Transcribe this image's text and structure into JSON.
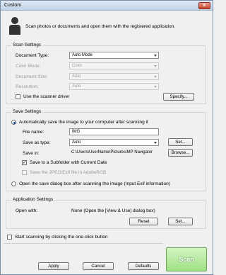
{
  "window": {
    "title": "Custom",
    "close_symbol": "x"
  },
  "intro_text": "Scan photos or documents and open them with the registered application.",
  "scan_settings": {
    "title": "Scan Settings",
    "document_type": {
      "label": "Document Type:",
      "value": "Auto Mode"
    },
    "color_mode": {
      "label": "Color Mode:",
      "value": "Color"
    },
    "document_size": {
      "label": "Document Size:",
      "value": "Auto"
    },
    "resolution": {
      "label": "Resolution:",
      "value": "Auto"
    },
    "use_driver_label": "Use the scanner driver",
    "specify_button": "Specify..."
  },
  "save_settings": {
    "title": "Save Settings",
    "auto_save_label": "Automatically save the image to your computer after scanning it",
    "file_name": {
      "label": "File name:",
      "value": "IMG"
    },
    "save_as_type": {
      "label": "Save as type:",
      "value": "Auto"
    },
    "set_button": "Set...",
    "save_in": {
      "label": "Save in:",
      "value": "C:\\Users\\UserName\\Pictures\\MP Navigator"
    },
    "browse_button": "Browse...",
    "subfolder_label": "Save to a Subfolder with Current Date",
    "jpeg_exif_label": "Save the JPEG/Exif file in AdobeRGB",
    "open_dialog_label": "Open the save dialog box after scanning the image (Input Exif information)"
  },
  "application_settings": {
    "title": "Application Settings",
    "open_with_label": "Open with:",
    "open_with_value": "None (Open the [View & Use] dialog box)",
    "reset_button": "Reset",
    "set_button": "Set..."
  },
  "start_scanning_label": "Start scanning by clicking the one-click button",
  "footer": {
    "apply": "Apply",
    "cancel": "Cancel",
    "defaults": "Defaults",
    "scan": "Scan"
  }
}
